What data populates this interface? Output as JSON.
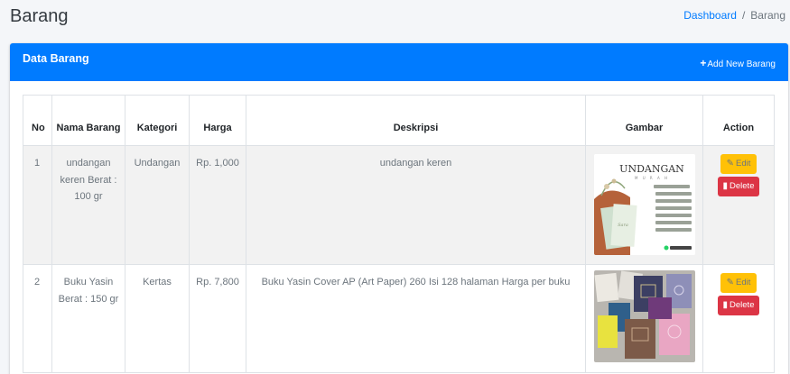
{
  "page": {
    "title": "Barang",
    "breadcrumb": {
      "home": "Dashboard",
      "separator": "/",
      "current": "Barang"
    }
  },
  "card": {
    "title": "Data Barang",
    "add_button": "Add New Barang",
    "header_color": "#007bff"
  },
  "table": {
    "columns": {
      "no": "No",
      "nama": "Nama Barang",
      "kategori": "Kategori",
      "harga": "Harga",
      "deskripsi": "Deskripsi",
      "gambar": "Gambar",
      "action": "Action"
    },
    "rows": [
      {
        "no": "1",
        "nama": "undangan keren Berat : 100 gr",
        "kategori": "Undangan",
        "harga": "Rp. 1,000",
        "deskripsi": "undangan keren",
        "image_text": "UNDANGAN",
        "edit": "Edit",
        "delete": "Delete"
      },
      {
        "no": "2",
        "nama": "Buku Yasin Berat : 150 gr",
        "kategori": "Kertas",
        "harga": "Rp. 7,800",
        "deskripsi": "Buku Yasin Cover AP (Art Paper) 260 Isi 128 halaman Harga per buku",
        "edit": "Edit",
        "delete": "Delete"
      }
    ]
  },
  "colors": {
    "edit": "#ffc107",
    "delete": "#dc3545",
    "link": "#007bff"
  },
  "icons": {
    "add": "plus-icon",
    "edit": "edit-icon",
    "delete": "trash-icon"
  }
}
